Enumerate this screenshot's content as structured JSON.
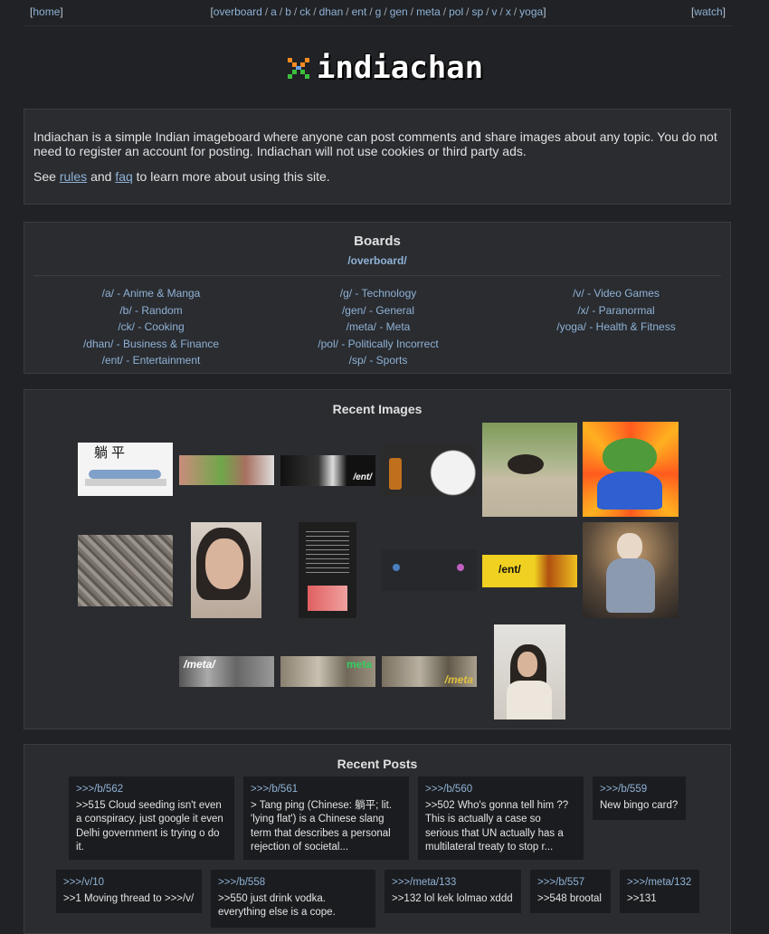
{
  "nav": {
    "home": "home",
    "boards": [
      "overboard",
      "a",
      "b",
      "ck",
      "dhan",
      "ent",
      "g",
      "gen",
      "meta",
      "pol",
      "sp",
      "v",
      "x",
      "yoga"
    ],
    "watch": "watch"
  },
  "logo": {
    "text": "indiachan"
  },
  "intro": {
    "line1": "Indiachan is a simple Indian imageboard where anyone can post comments and share images about any topic. You do not need to register an account for posting. Indiachan will not use cookies or third party ads.",
    "see": "See",
    "rules": "rules",
    "and": "and",
    "faq": "faq",
    "tail": "to learn more about using this site."
  },
  "boards": {
    "title": "Boards",
    "overboard": "/overboard/",
    "col1": [
      "/a/ - Anime & Manga",
      "/b/ - Random",
      "/ck/ - Cooking",
      "/dhan/ - Business & Finance",
      "/ent/ - Entertainment"
    ],
    "col2": [
      "/g/ - Technology",
      "/gen/ - General",
      "/meta/ - Meta",
      "/pol/ - Politically Incorrect",
      "/sp/ - Sports"
    ],
    "col3": [
      "/v/ - Video Games",
      "/x/ - Paranormal",
      "/yoga/ - Health & Fitness"
    ]
  },
  "images": {
    "title": "Recent Images",
    "kanji": "躺平",
    "ent_tag": "/ent/",
    "meta_tag": "/meta/",
    "meta_tag2": "meta",
    "meta_tag3": "/meta"
  },
  "posts": {
    "title": "Recent Posts",
    "row1": [
      {
        "ref": ">>>/b/562",
        "text": ">>515 Cloud seeding isn't even a conspiracy. just google it even Delhi government is trying o do it."
      },
      {
        "ref": ">>>/b/561",
        "text": "> Tang ping (Chinese: 躺平; lit. 'lying flat') is a Chinese slang term that describes a personal rejection of societal..."
      },
      {
        "ref": ">>>/b/560",
        "text": ">>502 Who's gonna tell him ?? This is actually a case so serious that UN actually has a multilateral treaty to stop r..."
      },
      {
        "ref": ">>>/b/559",
        "text": "New bingo card?"
      }
    ],
    "row2": [
      {
        "ref": ">>>/v/10",
        "text": ">>1 Moving thread to >>>/v/"
      },
      {
        "ref": ">>>/b/558",
        "text": ">>550 just drink vodka. everything else is a cope."
      },
      {
        "ref": ">>>/meta/133",
        "text": ">>132 lol kek lolmao xddd"
      },
      {
        "ref": ">>>/b/557",
        "text": ">>548 brootal"
      },
      {
        "ref": ">>>/meta/132",
        "text": ">>131"
      }
    ]
  },
  "colors": {
    "bg": "#202225",
    "panel": "#2a2c30",
    "link": "#8fb2d6",
    "post_bg": "#1b1c1f"
  }
}
